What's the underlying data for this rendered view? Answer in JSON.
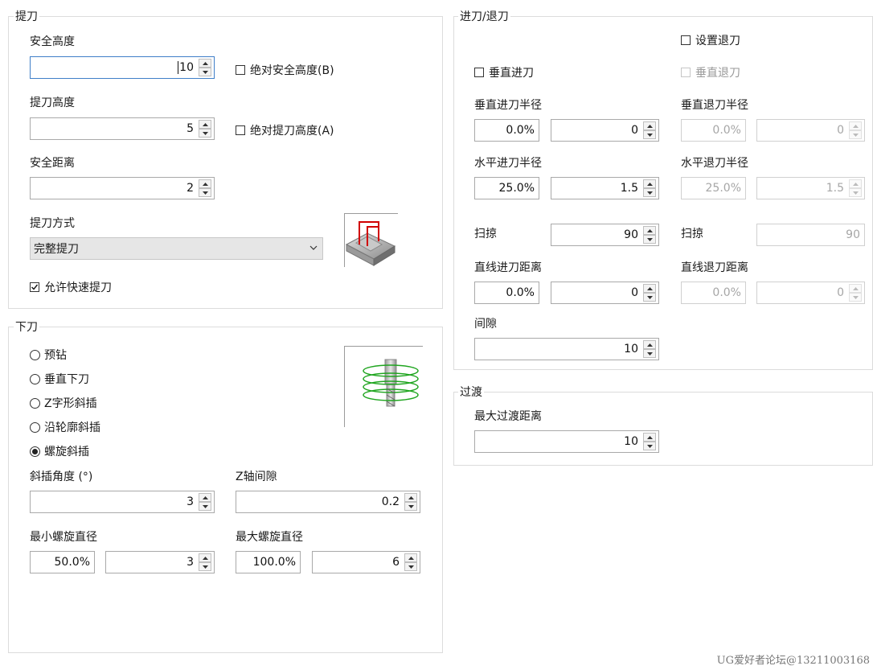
{
  "retract": {
    "group_title": "提刀",
    "safe_height_label": "安全高度",
    "safe_height_value": "10",
    "abs_safe_height_label": "绝对安全高度(B)",
    "abs_safe_height_checked": false,
    "retract_height_label": "提刀高度",
    "retract_height_value": "5",
    "abs_retract_height_label": "绝对提刀高度(A)",
    "abs_retract_height_checked": false,
    "safe_distance_label": "安全距离",
    "safe_distance_value": "2",
    "retract_mode_label": "提刀方式",
    "retract_mode_value": "完整提刀",
    "allow_rapid_label": "允许快速提刀",
    "allow_rapid_checked": true
  },
  "plunge": {
    "group_title": "下刀",
    "options": [
      {
        "label": "预钻",
        "selected": false
      },
      {
        "label": "垂直下刀",
        "selected": false
      },
      {
        "label": "Z字形斜插",
        "selected": false
      },
      {
        "label": "沿轮廓斜插",
        "selected": false
      },
      {
        "label": "螺旋斜插",
        "selected": true
      }
    ],
    "ramp_angle_label": "斜插角度 (°)",
    "ramp_angle_value": "3",
    "z_clearance_label": "Z轴间隙",
    "z_clearance_value": "0.2",
    "min_helix_label": "最小螺旋直径",
    "min_helix_percent": "50.0%",
    "min_helix_value": "3",
    "max_helix_label": "最大螺旋直径",
    "max_helix_percent": "100.0%",
    "max_helix_value": "6"
  },
  "leadinout": {
    "group_title": "进刀/退刀",
    "set_retract_label": "设置退刀",
    "set_retract_checked": false,
    "vertical_lead_in_label": "垂直进刀",
    "vertical_lead_in_checked": false,
    "vertical_lead_out_label": "垂直退刀",
    "vertical_lead_out_checked": false,
    "vert_in_radius_label": "垂直进刀半径",
    "vert_in_radius_percent": "0.0%",
    "vert_in_radius_value": "0",
    "vert_out_radius_label": "垂直退刀半径",
    "vert_out_radius_percent": "0.0%",
    "vert_out_radius_value": "0",
    "horiz_in_radius_label": "水平进刀半径",
    "horiz_in_radius_percent": "25.0%",
    "horiz_in_radius_value": "1.5",
    "horiz_out_radius_label": "水平退刀半径",
    "horiz_out_radius_percent": "25.0%",
    "horiz_out_radius_value": "1.5",
    "sweep_in_label": "扫掠",
    "sweep_in_value": "90",
    "sweep_out_label": "扫掠",
    "sweep_out_value": "90",
    "line_in_label": "直线进刀距离",
    "line_in_percent": "0.0%",
    "line_in_value": "0",
    "line_out_label": "直线退刀距离",
    "line_out_percent": "0.0%",
    "line_out_value": "0",
    "gap_label": "间隙",
    "gap_value": "10"
  },
  "transition": {
    "group_title": "过渡",
    "max_distance_label": "最大过渡距离",
    "max_distance_value": "10"
  },
  "watermark": "UG爱好者论坛@13211003168"
}
